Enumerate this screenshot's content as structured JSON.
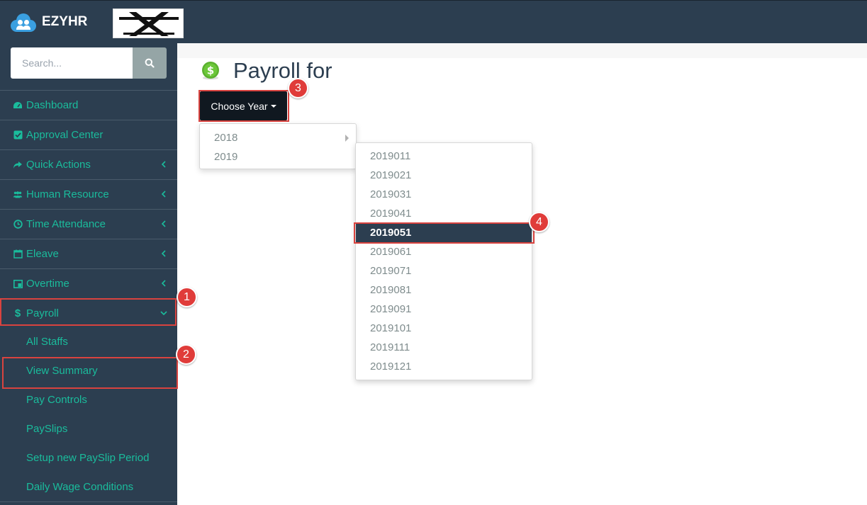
{
  "app": {
    "brand": "EZYHR",
    "brand_color": "#3a9fe0"
  },
  "sidebar": {
    "search": {
      "placeholder": "Search..."
    },
    "items": [
      {
        "label": "Dashboard",
        "icon": "dashboard-icon"
      },
      {
        "label": "Approval Center",
        "icon": "check-square-icon"
      },
      {
        "label": "Quick Actions",
        "icon": "share-arrow-icon"
      },
      {
        "label": "Human Resource",
        "icon": "users-icon"
      },
      {
        "label": "Time Attendance",
        "icon": "clock-icon"
      },
      {
        "label": "Eleave",
        "icon": "calendar-icon"
      },
      {
        "label": "Overtime",
        "icon": "overtime-icon"
      },
      {
        "label": "Payroll",
        "icon": "dollar-icon"
      }
    ],
    "payroll_submenu": [
      {
        "label": "All Staffs"
      },
      {
        "label": "View Summary"
      },
      {
        "label": "Pay Controls"
      },
      {
        "label": "PaySlips"
      },
      {
        "label": "Setup new PaySlip Period"
      },
      {
        "label": "Daily Wage Conditions"
      }
    ]
  },
  "main": {
    "title": "Payroll for",
    "choose_year_label": "Choose Year",
    "years": [
      {
        "label": "2018"
      },
      {
        "label": "2019"
      }
    ],
    "periods": [
      {
        "label": "2019011"
      },
      {
        "label": "2019021"
      },
      {
        "label": "2019031"
      },
      {
        "label": "2019041"
      },
      {
        "label": "2019051"
      },
      {
        "label": "2019061"
      },
      {
        "label": "2019071"
      },
      {
        "label": "2019081"
      },
      {
        "label": "2019091"
      },
      {
        "label": "2019101"
      },
      {
        "label": "2019111"
      },
      {
        "label": "2019121"
      }
    ],
    "selected_period": "2019051"
  },
  "annotations": {
    "step1": "1",
    "step2": "2",
    "step3": "3",
    "step4": "4",
    "color": "#d9433f"
  },
  "colors": {
    "sidebar_bg": "#2c3e50",
    "accent": "#1abc9c",
    "selected_bg": "#2c3e50"
  }
}
